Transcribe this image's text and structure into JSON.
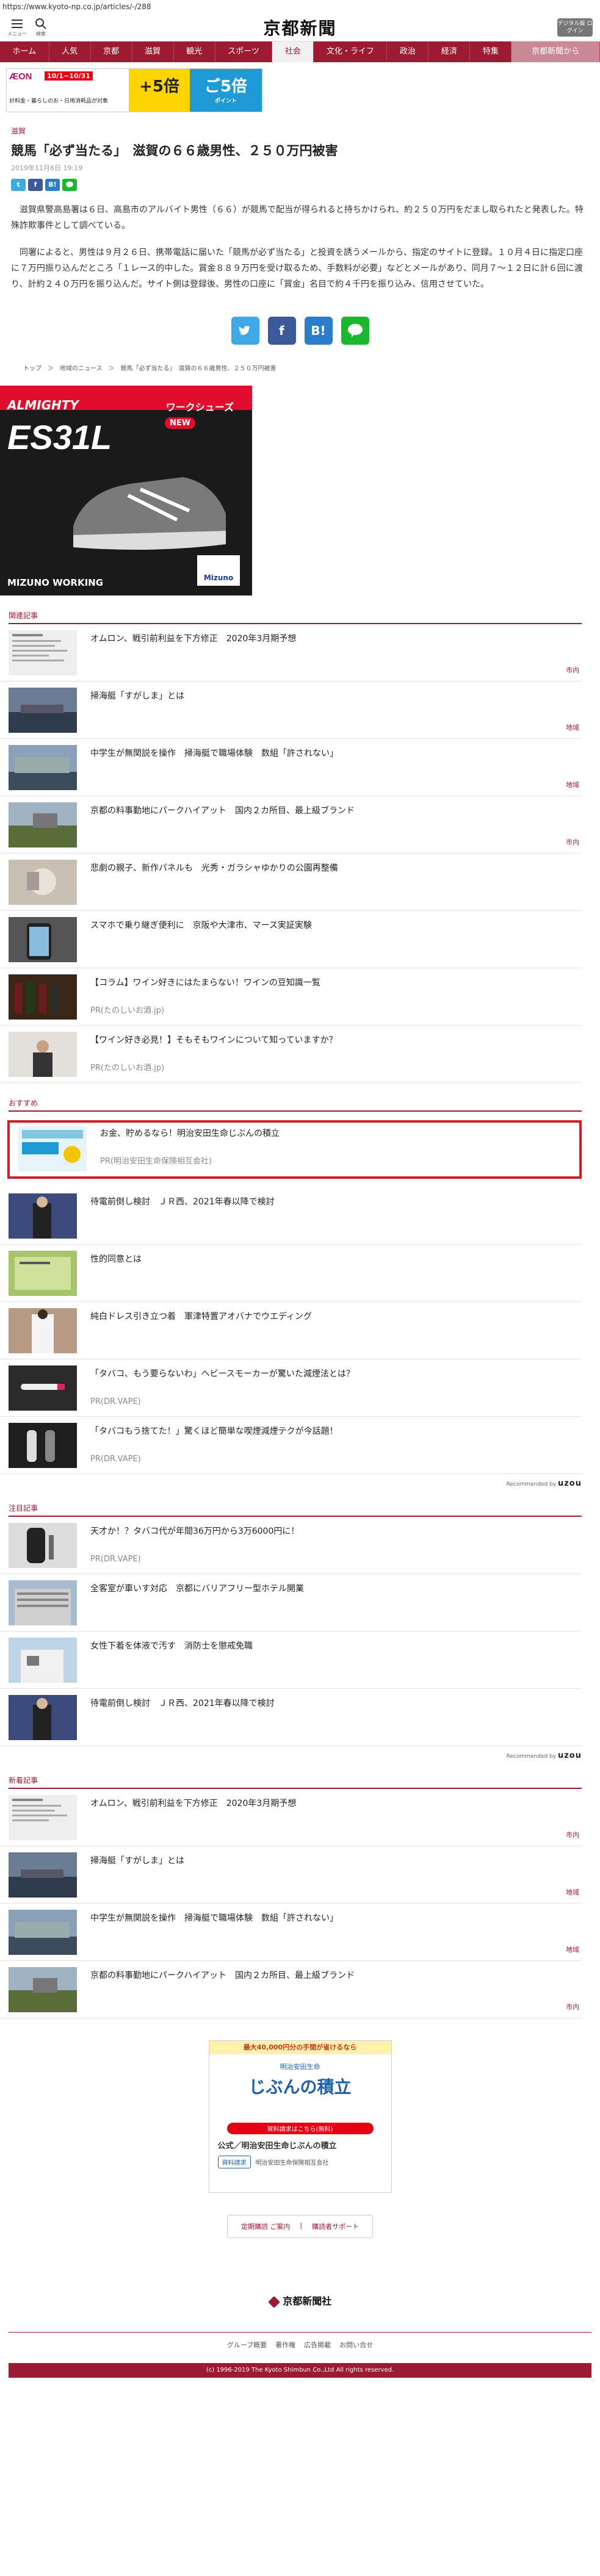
{
  "browser": {
    "url": "https://www.kyoto-np.co.jp/articles/-/288"
  },
  "header": {
    "menu_label": "メニュー",
    "search_label": "検索",
    "logo": "京都新聞",
    "login_label": "デジタル版 ログイン"
  },
  "nav": [
    "ホーム",
    "人気",
    "京都",
    "滋賀",
    "観光",
    "スポーツ",
    "社会",
    "文化・ライフ",
    "政治",
    "経済",
    "特集",
    "京都新聞から"
  ],
  "nav_active": "社会",
  "top_ad": {
    "brand": "ÆON",
    "dates": "10/1~10/31",
    "subtitle": "計料金・暮らしのお・日用消耗品が対象",
    "mid": "+5倍",
    "right": "ご5倍",
    "right_small": "ポイント"
  },
  "article": {
    "section": "滋賀",
    "title": "競馬「必ず当たる」　滋賀の６６歳男性、２５０万円被害",
    "date": "2019年11月6日 19:19",
    "paragraphs": [
      "滋賀県警高島署は６日、高島市のアルバイト男性（６６）が競馬で配当が得られると持ちかけられ、約２５０万円をだまし取られたと発表した。特殊詐欺事件として調べている。",
      "同署によると、男性は９月２６日、携帯電話に届いた「競馬が必ず当たる」と投資を誘うメールから、指定のサイトに登録。１０月４日に指定口座に７万円振り込んだところ「１レース的中した。賞金８８９万円を受け取るため、手数料が必要」などとメールがあり、同月７～１２日に計６回に渡り、計約２４０万円を振り込んだ。サイト側は登録後、男性の口座に「賞金」名目で約４千円を振り込み、信用させていた。"
    ]
  },
  "share": {
    "twitter": "t",
    "facebook": "f",
    "hatena": "B!",
    "line": "LINE"
  },
  "breadcrumb": [
    "トップ",
    "＞",
    "地域のニュース",
    "＞",
    "競馬「必ず当たる」　滋賀の６６歳男性、２５０万円被害"
  ],
  "promo": {
    "brand": "ALMIGHTY",
    "category": "ワークシューズ",
    "model": "ES31L",
    "badge": "NEW",
    "footer": "MIZUNO WORKING",
    "maker": "Mizuno"
  },
  "related": {
    "header": "関連記事",
    "items": [
      {
        "title": "オムロン、戦引前利益を下方修正　2020年3月期予想",
        "tag": "市内",
        "sub": ""
      },
      {
        "title": "掃海艇「すがしま」とは",
        "tag": "地域",
        "sub": ""
      },
      {
        "title": "中学生が無関説を操作　掃海艇で職場体験　数組「許されない」",
        "tag": "地域",
        "sub": ""
      },
      {
        "title": "京都の料事勤地にパークハイアット　国内２カ所目、最上級ブランド",
        "tag": "市内",
        "sub": ""
      },
      {
        "title": "悲劇の親子、新作パネルも　光秀・ガラシャゆかりの公園再整備",
        "tag": "",
        "sub": ""
      },
      {
        "title": "スマホで乗り継ぎ便利に　京阪や大津市、マース実証実験",
        "tag": "",
        "sub": ""
      },
      {
        "title": "【コラム】ワイン好きにはたまらない！ワインの豆知識一覧",
        "tag": "",
        "sub": "PR(たのしいお酒.jp)"
      },
      {
        "title": "【ワイン好き必見！】そもそもワインについて知っていますか？",
        "tag": "",
        "sub": "PR(たのしいお酒.jp)"
      }
    ]
  },
  "recommend": {
    "header": "おすすめ",
    "items": [
      {
        "title": "お金、貯めるなら！明治安田生命じぶんの積立",
        "sub": "PR(明治安田生命保険相互会社)"
      },
      {
        "title": "待電前倒し検討　ＪＲ西、2021年春以降で検討",
        "sub": ""
      },
      {
        "title": "性的同意とは",
        "sub": ""
      },
      {
        "title": "純白ドレス引き立つ着　軍津特置アオバナでウエディング",
        "sub": ""
      },
      {
        "title": "「タバコ、もう要らないわ」ヘビースモーカーが驚いた減煙法とは？",
        "sub": "PR(DR.VAPE)"
      },
      {
        "title": "「タバコもう捨てた！」驚くほど簡単な喫煙減煙テクが今話題！",
        "sub": "PR(DR.VAPE)"
      }
    ],
    "powered": "Recommended by",
    "powered_brand": "uzou"
  },
  "attention": {
    "header": "注目記事",
    "items": [
      {
        "title": "天才か！？タバコ代が年間36万円から3万6000円に！",
        "sub": "PR(DR.VAPE)"
      },
      {
        "title": "全客室が車いす対応　京都にバリアフリー型ホテル開業",
        "sub": ""
      },
      {
        "title": "女性下着を体液で汚す　消防士を懲戒免職",
        "sub": ""
      },
      {
        "title": "待電前倒し検討　ＪＲ西、2021年春以降で検討",
        "sub": ""
      }
    ],
    "powered": "Recommended by",
    "powered_brand": "uzou"
  },
  "newest": {
    "header": "新着記事",
    "items": [
      {
        "title": "オムロン、戦引前利益を下方修正　2020年3月期予想",
        "tag": "市内"
      },
      {
        "title": "掃海艇「すがしま」とは",
        "tag": "地域"
      },
      {
        "title": "中学生が無関説を操作　掃海艇で職場体験　数組「許されない」",
        "tag": "地域"
      },
      {
        "title": "京都の料事勤地にパークハイアット　国内２カ所目、最上級ブランド",
        "tag": "市内"
      }
    ]
  },
  "bottom_ad": {
    "top": "最大40,000円分の手間が省けるなら",
    "company_small": "明治安田生命",
    "product": "じぶんの積立",
    "button": "資料請求はこちら(無料)",
    "name": "公式／明治安田生命じぶんの積立",
    "company": "明治安田生命保険相互会社",
    "cta": "資料請求"
  },
  "support": {
    "left": "定期購読 ご案内",
    "right": "購読者サポート"
  },
  "footer": {
    "logo": "京都新聞社",
    "links": [
      "グループ概要",
      "著作権",
      "広告掲載",
      "お問い合せ"
    ],
    "copyright": "(c) 1996-2019 The Kyoto Shimbun Co.,Ltd All rights reserved."
  },
  "colors": {
    "brand": "#9c1a32",
    "highlight": "#d01e26"
  }
}
